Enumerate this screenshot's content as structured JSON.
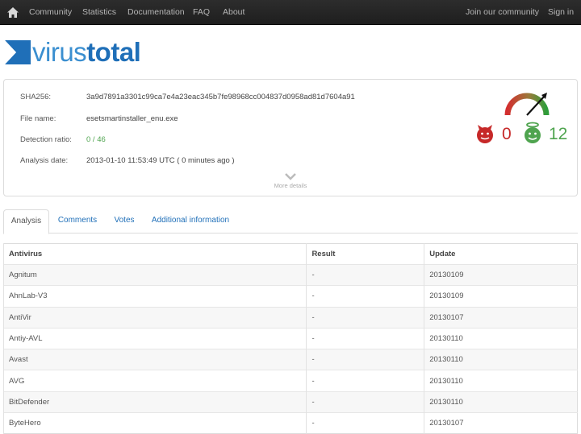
{
  "navbar": {
    "home_icon": "home-icon",
    "left_links": [
      "Community",
      "Statistics",
      "Documentation",
      "FAQ",
      "About"
    ],
    "right_links": [
      "Join our community",
      "Sign in"
    ]
  },
  "logo": {
    "part1": "virus",
    "part2": "total",
    "brand_color": "#1f6fb8"
  },
  "summary": {
    "sha256_label": "SHA256:",
    "sha256_value": "3a9d7891a3301c99ca7e4a23eac345b7fe98968cc004837d0958ad81d7604a91",
    "filename_label": "File name:",
    "filename_value": "esetsmartinstaller_enu.exe",
    "ratio_label": "Detection ratio:",
    "ratio_value": "0 / 46",
    "date_label": "Analysis date:",
    "date_value": "2013-01-10 11:53:49 UTC ( 0 minutes ago )",
    "more_details": "More details",
    "bad_votes": "0",
    "good_votes": "12",
    "bad_color": "#c62828",
    "good_color": "#4fa44f"
  },
  "tabs": [
    {
      "label": "Analysis",
      "active": true
    },
    {
      "label": "Comments",
      "active": false
    },
    {
      "label": "Votes",
      "active": false
    },
    {
      "label": "Additional information",
      "active": false
    }
  ],
  "table": {
    "headers": [
      "Antivirus",
      "Result",
      "Update"
    ],
    "rows": [
      [
        "Agnitum",
        "-",
        "20130109"
      ],
      [
        "AhnLab-V3",
        "-",
        "20130109"
      ],
      [
        "AntiVir",
        "-",
        "20130107"
      ],
      [
        "Antiy-AVL",
        "-",
        "20130110"
      ],
      [
        "Avast",
        "-",
        "20130110"
      ],
      [
        "AVG",
        "-",
        "20130110"
      ],
      [
        "BitDefender",
        "-",
        "20130110"
      ],
      [
        "ByteHero",
        "-",
        "20130107"
      ]
    ]
  }
}
